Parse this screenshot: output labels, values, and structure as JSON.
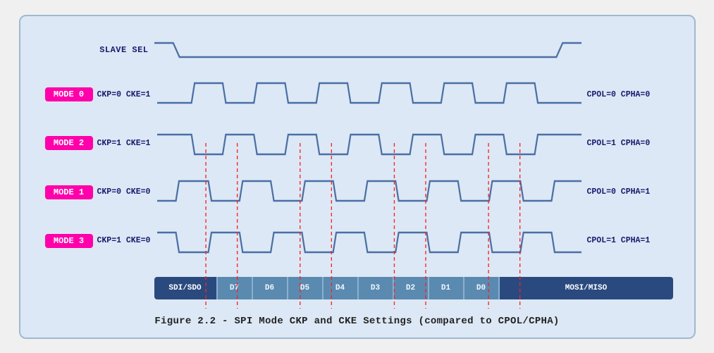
{
  "caption": "Figure 2.2 - SPI Mode CKP and CKE Settings (compared to CPOL/CPHA)",
  "slave_label": "SLAVE SEL",
  "modes": [
    {
      "id": "MODE 0",
      "params": "CKP=0  CKE=1",
      "right": "CPOL=0  CPHA=0",
      "type": "high_idle"
    },
    {
      "id": "MODE 2",
      "params": "CKP=1  CKE=1",
      "right": "CPOL=1  CPHA=0",
      "type": "low_idle"
    },
    {
      "id": "MODE 1",
      "params": "CKP=0  CKE=0",
      "right": "CPOL=0  CPHA=1",
      "type": "high_idle_phase"
    },
    {
      "id": "MODE 3",
      "params": "CKP=1  CKE=0",
      "right": "CPOL=1  CPHA=1",
      "type": "low_idle_phase"
    }
  ],
  "data_cells": [
    "SDI/SDO",
    "D7",
    "D6",
    "D5",
    "D4",
    "D3",
    "D2",
    "D1",
    "D0",
    "MOSI/MISO"
  ],
  "vline_positions": [
    8,
    17,
    26,
    35,
    44,
    53,
    62,
    71,
    80
  ],
  "colors": {
    "signal": "#4a6fa5",
    "signal_stroke": "#3a5f95",
    "red_dashed": "#ff2020",
    "dark_cell": "#2a4a7f",
    "light_cell": "#5a8ab0",
    "badge_bg": "#ff00aa"
  }
}
